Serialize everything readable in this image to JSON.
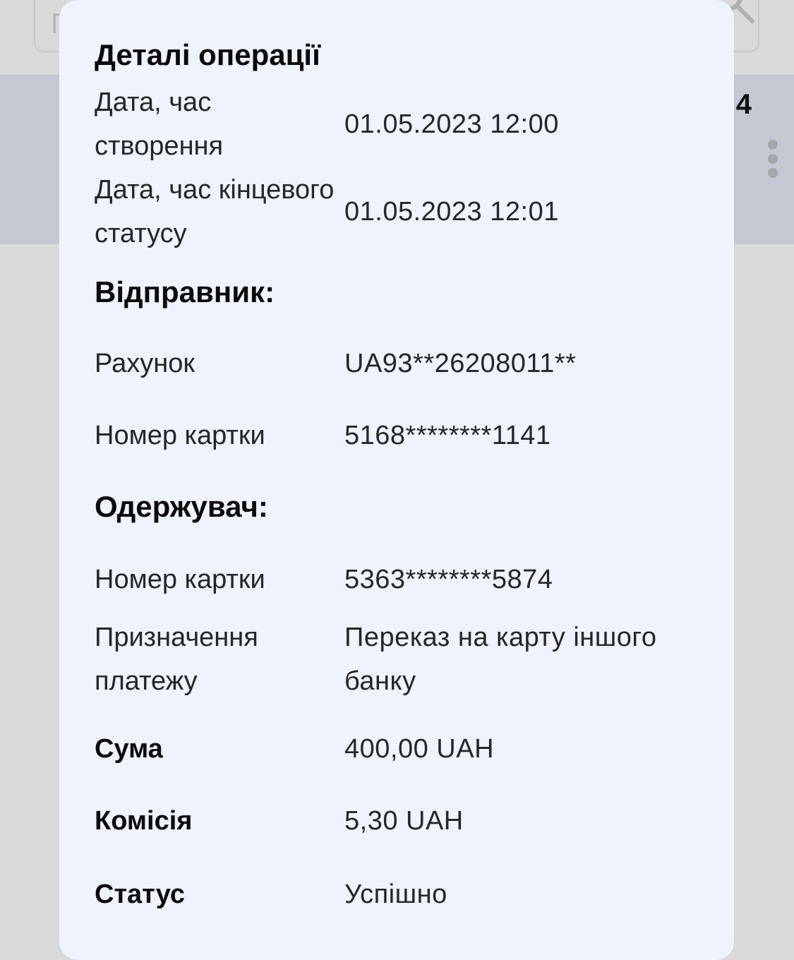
{
  "background": {
    "search_hint": "П",
    "band_number": "4"
  },
  "modal": {
    "title": "Деталі операції",
    "created": {
      "label": "Дата, час створення",
      "value": "01.05.2023  12:00"
    },
    "final_status_time": {
      "label": "Дата, час кінцевого статусу",
      "value": "01.05.2023  12:01"
    },
    "sender": {
      "heading": "Відправник:",
      "account": {
        "label": "Рахунок",
        "value": "UA93**26208011**"
      },
      "card": {
        "label": "Номер картки",
        "value": "5168********1141"
      }
    },
    "recipient": {
      "heading": "Одержувач:",
      "card": {
        "label": "Номер картки",
        "value": "5363********5874"
      },
      "purpose": {
        "label": "Призначення платежу",
        "value": "Переказ на карту іншого банку"
      }
    },
    "amount": {
      "label": "Сума",
      "value": "400,00 UAH"
    },
    "fee": {
      "label": "Комісія",
      "value": "5,30 UAH"
    },
    "status": {
      "label": "Статус",
      "value": "Успішно"
    }
  },
  "colors": {
    "modal_bg": "#eef3fe",
    "text": "#262626",
    "heading": "#0b0b0b",
    "overlay": "#d9d9d9"
  }
}
